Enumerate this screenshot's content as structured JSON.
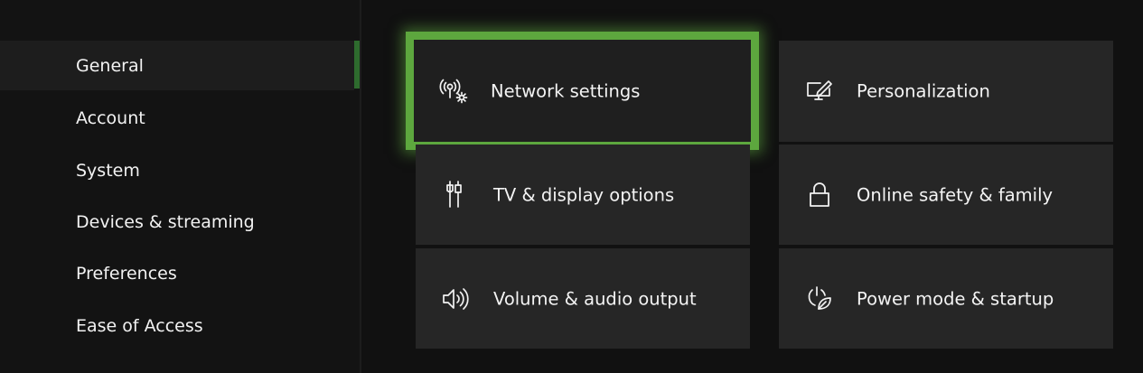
{
  "sidebar": {
    "items": [
      {
        "label": "General",
        "selected": true
      },
      {
        "label": "Account"
      },
      {
        "label": "System"
      },
      {
        "label": "Devices & streaming"
      },
      {
        "label": "Preferences"
      },
      {
        "label": "Ease of Access"
      }
    ],
    "indicator_color": "#2e6b2e"
  },
  "tiles": [
    {
      "label": "Network settings",
      "icon": "network-settings-icon",
      "focused": true
    },
    {
      "label": "Personalization",
      "icon": "personalization-icon"
    },
    {
      "label": "TV & display options",
      "icon": "tv-display-icon"
    },
    {
      "label": "Online safety & family",
      "icon": "lock-icon"
    },
    {
      "label": "Volume & audio output",
      "icon": "speaker-icon"
    },
    {
      "label": "Power mode & startup",
      "icon": "power-leaf-icon"
    }
  ],
  "colors": {
    "focus": "#5da73e",
    "tile": "#262626",
    "background": "#111111"
  }
}
